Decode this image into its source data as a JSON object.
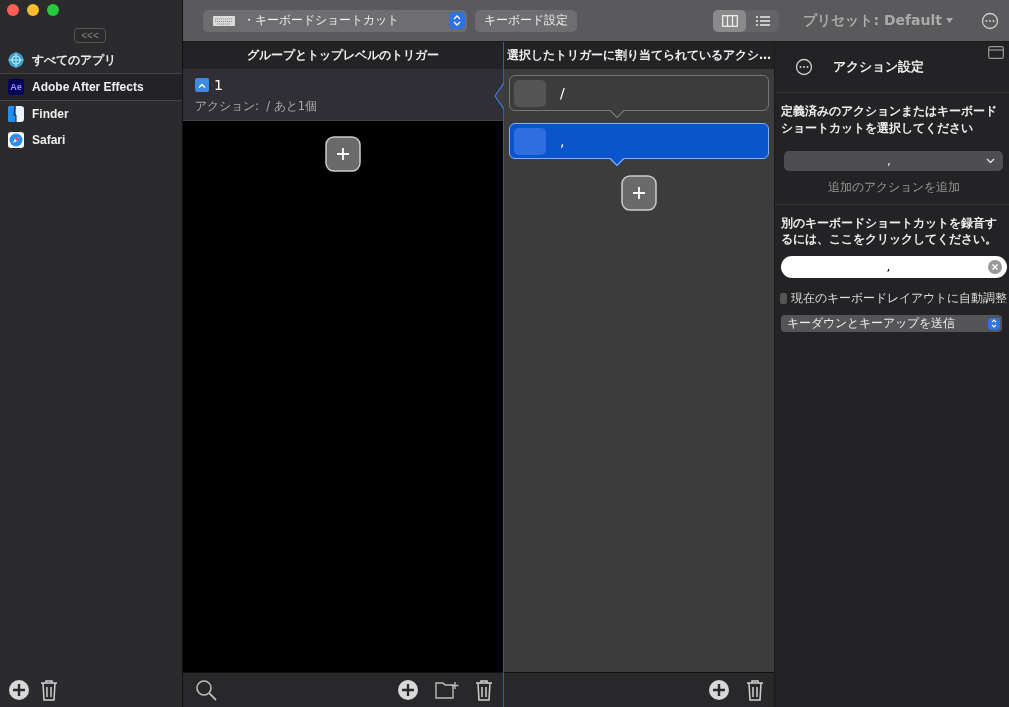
{
  "sidebar": {
    "collapse_button": "<<<",
    "apps": [
      {
        "name": "すべてのアプリ",
        "kind": "all",
        "selected": false
      },
      {
        "name": "Adobe After Effects",
        "kind": "badge",
        "badge": "Ae",
        "selected": true
      },
      {
        "name": "Finder",
        "kind": "finder",
        "selected": false
      },
      {
        "name": "Safari",
        "kind": "safari",
        "selected": false
      }
    ]
  },
  "toolbar": {
    "trigger_type": "・キーボードショートカット",
    "keyboard_settings": "キーボード設定",
    "view_modes": [
      {
        "kind": "columns",
        "selected": true
      },
      {
        "kind": "list",
        "selected": false
      }
    ],
    "preset": "プリセット: Default"
  },
  "triggers": {
    "header": "グループとトップレベルのトリガー",
    "items": [
      {
        "name": "1",
        "detail": "アクション:  / あと1個",
        "selected": true
      }
    ]
  },
  "actions": {
    "header": "選択したトリガーに割り当てられているアクシ…",
    "items": [
      {
        "label": "/",
        "selected": false
      },
      {
        "label": ",",
        "selected": true
      }
    ]
  },
  "action_settings": {
    "title": "アクション設定",
    "predefined_prompt": "定義済みのアクションまたはキーボードショートカットを選択してください",
    "predefined_value": ",",
    "add_action": "追加のアクションを追加",
    "record_prompt": "別のキーボードショートカットを録音するには、ここをクリックしてください。",
    "recorded_value": ",",
    "auto_adjust": {
      "label": "現在のキーボードレイアウトに自動調整",
      "checked": false
    },
    "send_mode": "キーダウンとキーアップを送信"
  }
}
